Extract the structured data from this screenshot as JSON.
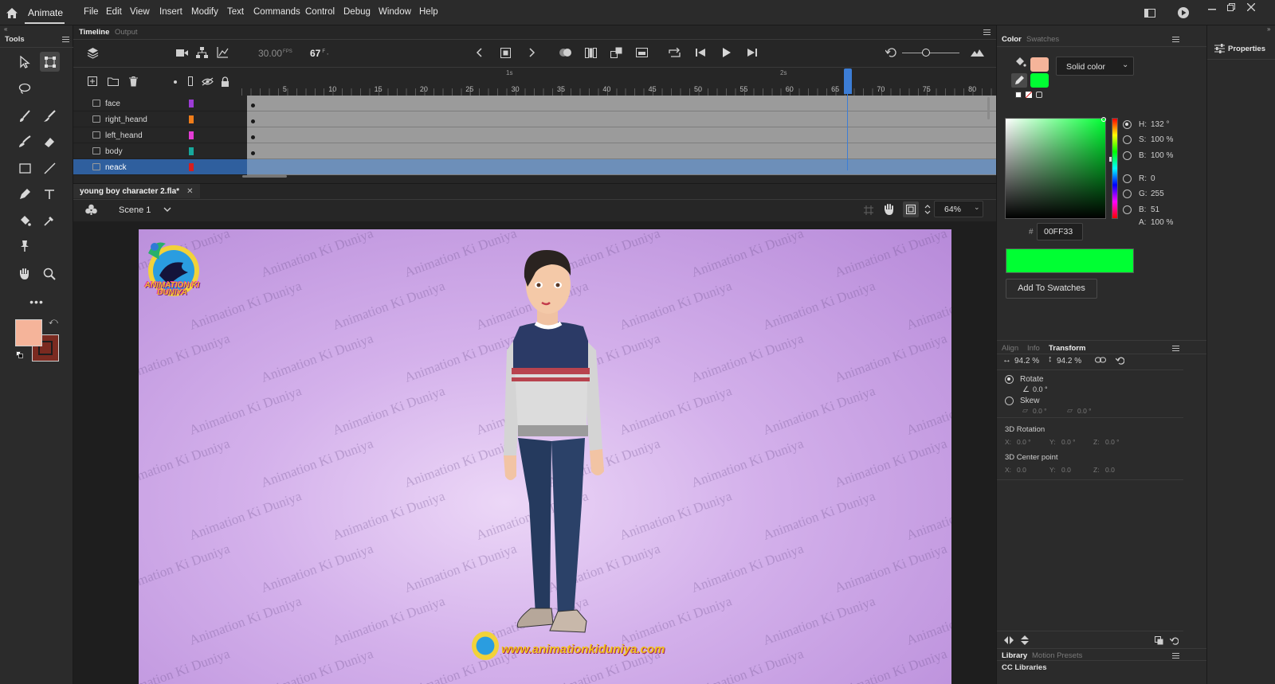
{
  "app": {
    "name": "Animate"
  },
  "menu": [
    "File",
    "Edit",
    "View",
    "Insert",
    "Modify",
    "Text",
    "Commands",
    "Control",
    "Debug",
    "Window",
    "Help"
  ],
  "tools_panel": {
    "title": "Tools",
    "fill_color": "#f5b49a",
    "stroke_color": "#7a2a20"
  },
  "timeline": {
    "tabs": [
      "Timeline",
      "Output"
    ],
    "fps": "30.00",
    "fps_unit": "FPS",
    "frame": "67",
    "frame_unit": "F",
    "second_markers": [
      "1s",
      "2s"
    ],
    "ticks": [
      "5",
      "10",
      "15",
      "20",
      "25",
      "30",
      "35",
      "40",
      "45",
      "50",
      "55",
      "60",
      "65",
      "70",
      "75",
      "80"
    ],
    "current_frame": 67,
    "layers": [
      {
        "name": "face",
        "color": "#9d3cd6"
      },
      {
        "name": "right_heand",
        "color": "#f07d1a"
      },
      {
        "name": "left_heand",
        "color": "#e53cd6"
      },
      {
        "name": "body",
        "color": "#17a89c"
      },
      {
        "name": "neack",
        "color": "#d61e1e",
        "selected": true
      }
    ]
  },
  "document": {
    "tab": "young boy character 2.fla*",
    "scene": "Scene 1",
    "zoom": "64%",
    "watermark": "Animation Ki Duniya",
    "logo_text": "ANIMATION KI DUNIYA",
    "footer_url": "www.animationkiduniya.com"
  },
  "color_panel": {
    "tabs": [
      "Color",
      "Swatches"
    ],
    "type": "Solid color",
    "fill_swatch": "#f5b49a",
    "stroke_swatch": "#00ff33",
    "hsb": {
      "h_label": "H:",
      "h": "132 °",
      "s_label": "S:",
      "s": "100 %",
      "b_label": "B:",
      "b": "100 %"
    },
    "rgb": {
      "r_label": "R:",
      "r": "0",
      "g_label": "G:",
      "g": "255",
      "b_label": "B:",
      "b": "51"
    },
    "alpha_label": "A:",
    "alpha": "100 %",
    "hex_label": "#",
    "hex": "00FF33",
    "preview_color": "#00ff33",
    "add_swatch": "Add To Swatches"
  },
  "transform_panel": {
    "tabs": [
      "Align",
      "Info",
      "Transform"
    ],
    "width": "94.2 %",
    "height": "94.2 %",
    "rotate_label": "Rotate",
    "rotate": "0.0 °",
    "skew_label": "Skew",
    "skew_h": "0.0 °",
    "skew_v": "0.0 °",
    "rot3d_label": "3D Rotation",
    "rot3d": {
      "x_label": "X:",
      "x": "0.0 °",
      "y_label": "Y:",
      "y": "0.0 °",
      "z_label": "Z:",
      "z": "0.0 °"
    },
    "center3d_label": "3D Center point",
    "center3d": {
      "x_label": "X:",
      "x": "0.0",
      "y_label": "Y:",
      "y": "0.0",
      "z_label": "Z:",
      "z": "0.0"
    }
  },
  "library": {
    "tabs": [
      "Library",
      "Motion Presets"
    ],
    "sub": "CC Libraries"
  },
  "properties": {
    "title": "Properties"
  }
}
